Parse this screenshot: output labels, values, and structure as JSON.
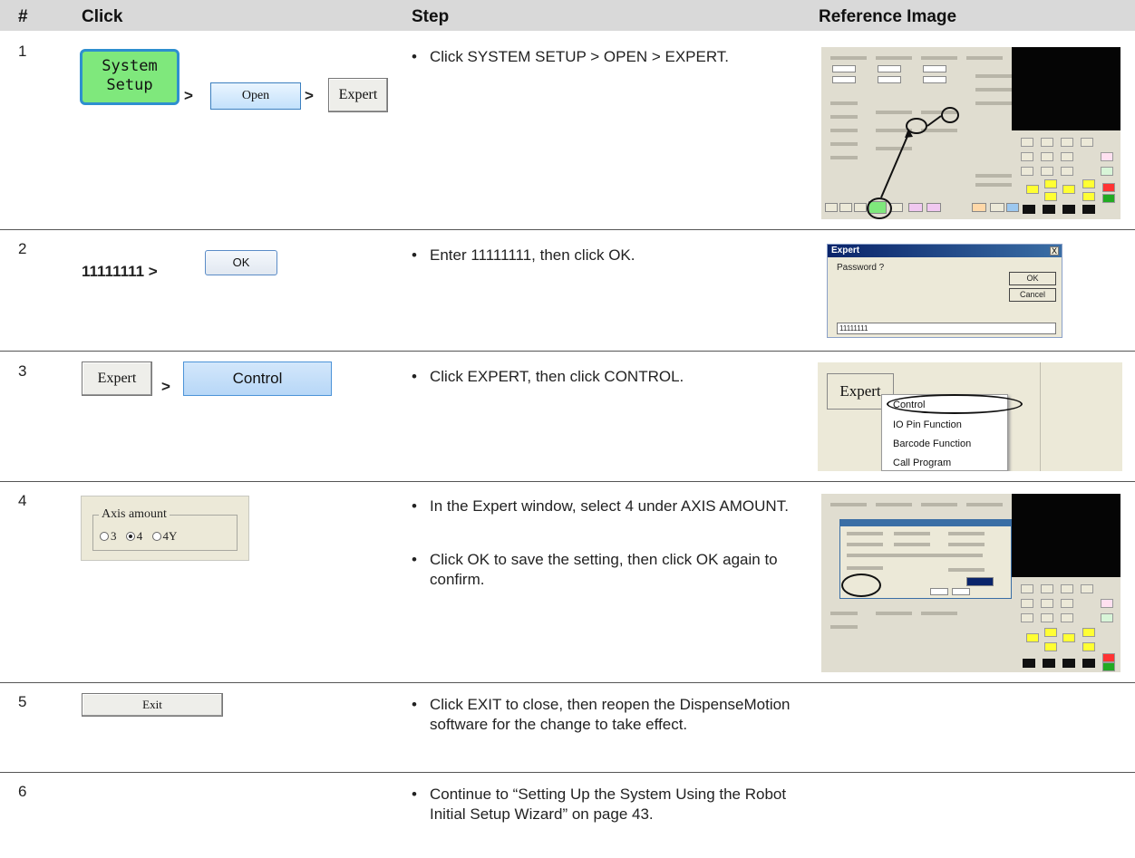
{
  "header": {
    "col_num": "#",
    "col_click": "Click",
    "col_step": "Step",
    "col_ref": "Reference Image"
  },
  "rows": [
    {
      "num": "1",
      "click": {
        "system_setup_line1": "System",
        "system_setup_line2": "Setup",
        "sep1": ">",
        "open": "Open",
        "sep2": ">",
        "expert": "Expert"
      },
      "steps": [
        "Click SYSTEM SETUP > OPEN > EXPERT."
      ]
    },
    {
      "num": "2",
      "click": {
        "prefix": "11111111 >",
        "ok": "OK"
      },
      "steps": [
        "Enter 11111111, then click OK."
      ],
      "ref": {
        "title": "Expert",
        "close": "X",
        "prompt": "Password ?",
        "ok": "OK",
        "cancel": "Cancel",
        "value": "11111111"
      }
    },
    {
      "num": "3",
      "click": {
        "expert": "Expert",
        "sep": ">",
        "control": "Control"
      },
      "steps": [
        "Click EXPERT, then click CONTROL."
      ],
      "ref": {
        "button": "Expert",
        "menu": [
          "Control",
          "IO Pin Function",
          "Barcode Function",
          "Call Program"
        ]
      }
    },
    {
      "num": "4",
      "click": {
        "legend": "Axis amount",
        "options": [
          "3",
          "4",
          "4Y"
        ],
        "selected": "4"
      },
      "steps": [
        "In the Expert window, select 4 under AXIS AMOUNT.",
        "Click OK to save the setting, then click OK again to confirm."
      ]
    },
    {
      "num": "5",
      "click": {
        "exit": "Exit"
      },
      "steps": [
        "Click EXIT to close, then reopen the DispenseMotion software for the change to take effect."
      ]
    },
    {
      "num": "6",
      "steps": [
        "Continue to “Setting Up the System Using the Robot Initial Setup Wizard” on page 43."
      ]
    }
  ],
  "colors": {
    "header_bg": "#d9d9d9",
    "rule": "#555555",
    "system_setup_green": "#7fe87c",
    "highlight_blue": "#2e8fcf"
  }
}
